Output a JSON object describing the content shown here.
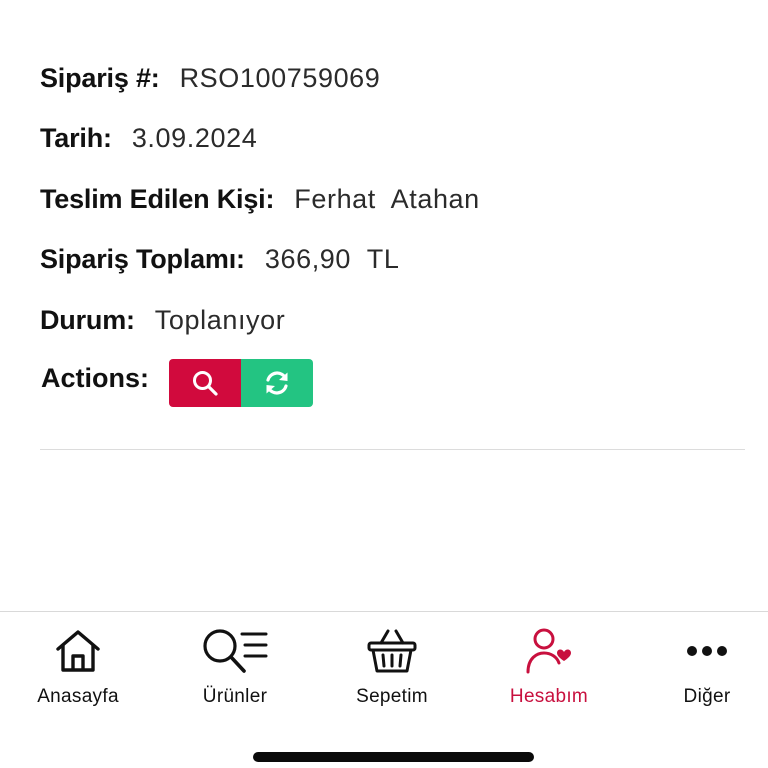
{
  "order": {
    "fields": [
      {
        "label": "Sipariş #:",
        "value": "RSO100759069"
      },
      {
        "label": "Tarih:",
        "value": "3.09.2024"
      },
      {
        "label": "Teslim Edilen Kişi:",
        "value": "Ferhat  Atahan"
      },
      {
        "label": "Sipariş Toplamı:",
        "value": "366,90  TL"
      },
      {
        "label": "Durum:",
        "value": "Toplanıyor"
      }
    ],
    "actions_label": "Actions:",
    "actions": [
      {
        "name": "search",
        "icon": "search-icon",
        "color": "#d10a3d"
      },
      {
        "name": "refresh",
        "icon": "refresh-icon",
        "color": "#23c482"
      }
    ]
  },
  "tabbar": {
    "items": [
      {
        "label": "Anasayfa",
        "icon": "home-icon",
        "active": false
      },
      {
        "label": "Ürünler",
        "icon": "products-list-icon",
        "active": false
      },
      {
        "label": "Sepetim",
        "icon": "basket-icon",
        "active": false
      },
      {
        "label": "Hesabım",
        "icon": "account-heart-icon",
        "active": true
      },
      {
        "label": "Diğer",
        "icon": "more-dots-icon",
        "active": false
      }
    ],
    "active_color": "#c8103e"
  }
}
